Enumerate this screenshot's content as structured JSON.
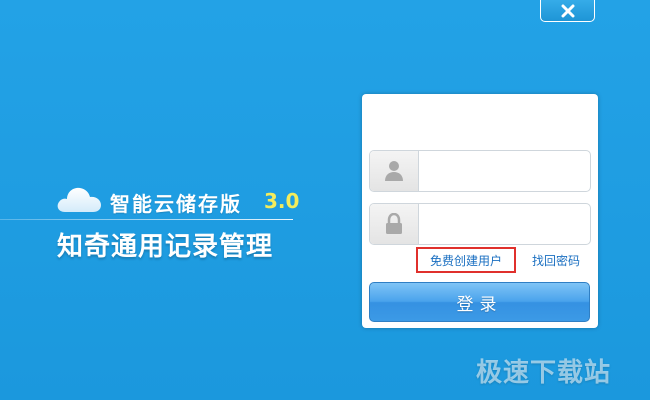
{
  "window": {
    "close_icon": "close-icon",
    "accent_color": "#1f9de2"
  },
  "brand": {
    "logo_icon": "cloud-icon",
    "product_name": "智能云储存版",
    "version": "3.0",
    "title": "知奇通用记录管理"
  },
  "login": {
    "username_icon": "user-icon",
    "username_value": "",
    "password_icon": "lock-icon",
    "password_value": "",
    "register_link": "免费创建用户",
    "forgot_link": "找回密码",
    "submit_label": "登录",
    "highlight_color": "#e0302c"
  },
  "watermark": "极速下载站"
}
